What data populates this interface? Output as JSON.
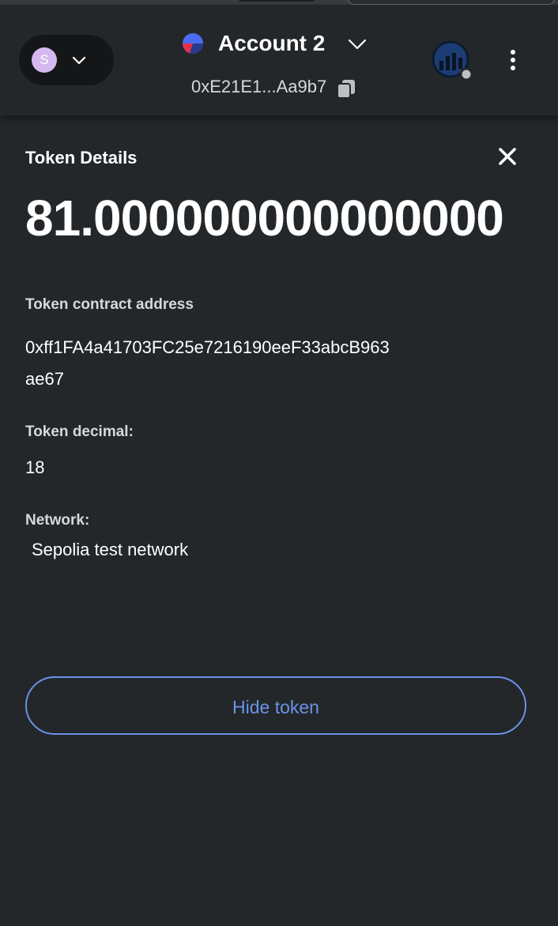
{
  "header": {
    "network_avatar_letter": "S",
    "account_name": "Account 2",
    "account_address": "0xE21E1...Aa9b7",
    "icons": {
      "network_chevron": "chevron-down-icon",
      "account_chevron": "chevron-down-icon",
      "copy": "copy-icon",
      "connection": "connected-site-icon",
      "menu": "kebab-menu-icon"
    }
  },
  "token_details": {
    "title": "Token Details",
    "balance": "81.000000000000000",
    "contract_label": "Token contract address",
    "contract_address": "0xff1FA4a41703FC25e7216190eeF33abcB963ae67",
    "decimal_label": "Token decimal:",
    "decimal_value": "18",
    "network_label": "Network:",
    "network_value": "Sepolia test network",
    "hide_button_label": "Hide token"
  },
  "colors": {
    "background": "#24272a",
    "accent": "#6a93e8",
    "avatar": "#d6b8f0"
  }
}
